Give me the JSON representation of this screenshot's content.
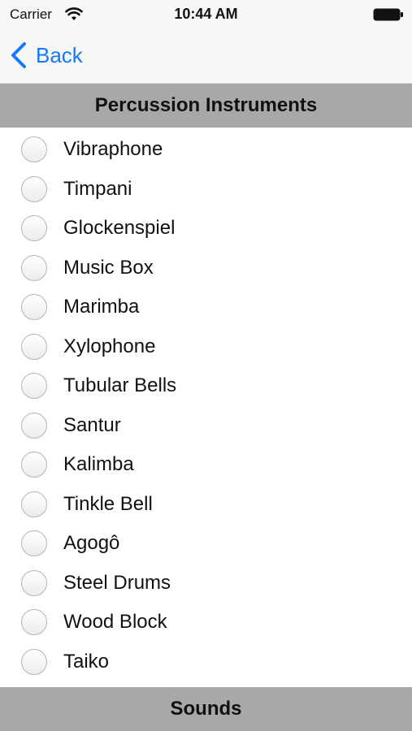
{
  "statusbar": {
    "carrier": "Carrier",
    "time": "10:44 AM"
  },
  "nav": {
    "back_label": "Back"
  },
  "section_title": "Percussion Instruments",
  "instruments": [
    "Vibraphone",
    "Timpani",
    "Glockenspiel",
    "Music Box",
    "Marimba",
    "Xylophone",
    "Tubular Bells",
    "Santur",
    "Kalimba",
    "Tinkle Bell",
    "Agogô",
    "Steel Drums",
    "Wood Block",
    "Taiko"
  ],
  "footer_title": "Sounds",
  "colors": {
    "accent": "#1479f5",
    "header_bg": "#a8a8a8"
  },
  "icons": {
    "wifi": "wifi-icon",
    "battery": "battery-icon",
    "back": "chevron-left-icon",
    "radio": "radio-unselected-icon"
  }
}
